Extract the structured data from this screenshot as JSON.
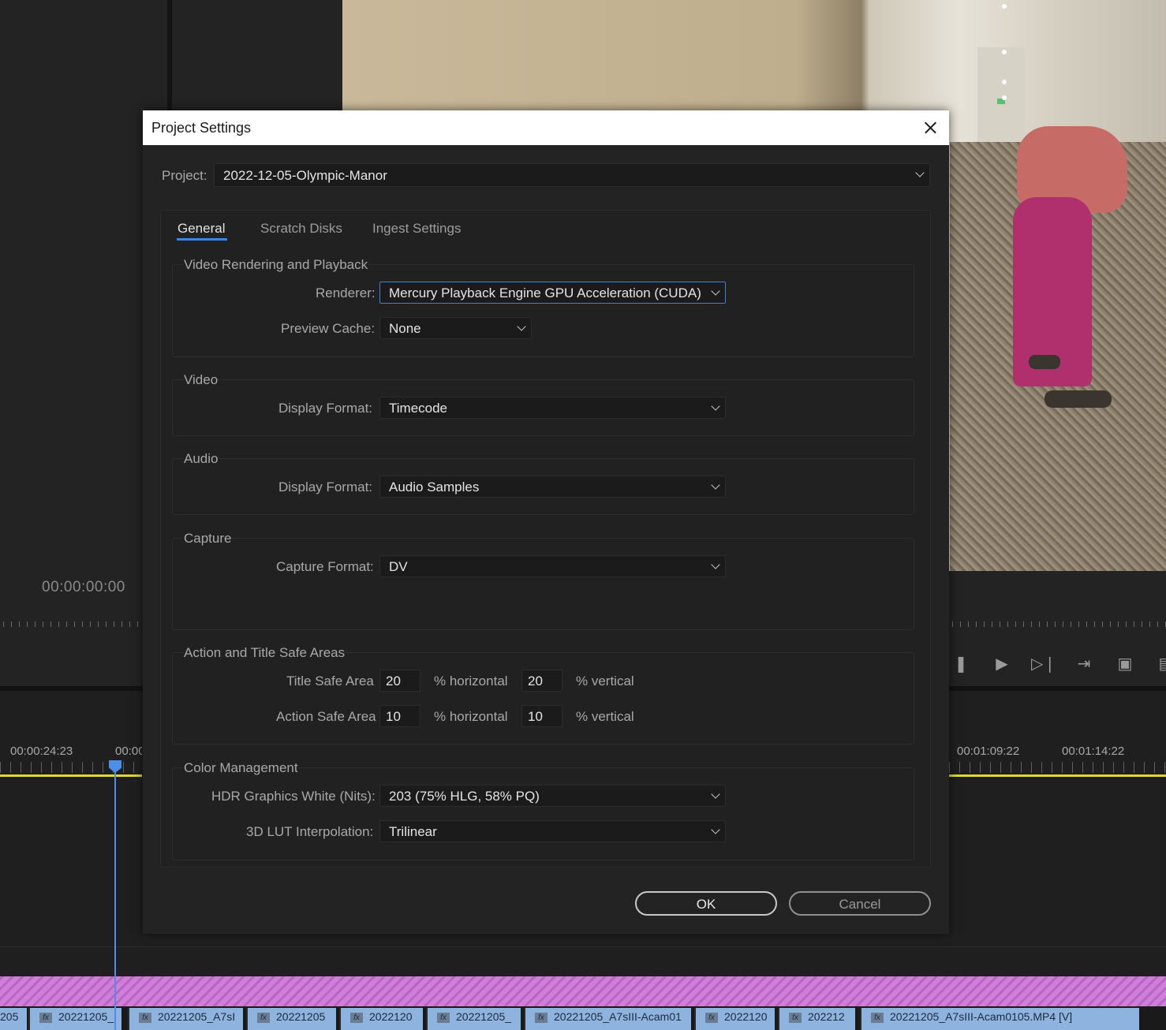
{
  "background": {
    "source_timecode": "00:00:00:00",
    "timeline_timecodes": [
      "00:00:24:23",
      "00:00",
      "00:01:09:22",
      "00:01:14:22"
    ],
    "clips": [
      {
        "label": "205",
        "fx": false
      },
      {
        "label": "20221205_",
        "fx": true
      },
      {
        "label": "20221205_A7sI",
        "fx": true
      },
      {
        "label": "20221205",
        "fx": true
      },
      {
        "label": "2022120",
        "fx": true
      },
      {
        "label": "20221205_",
        "fx": true
      },
      {
        "label": "20221205_A7sIII-Acam01",
        "fx": true
      },
      {
        "label": "2022120",
        "fx": true
      },
      {
        "label": "202212",
        "fx": true
      },
      {
        "label": "20221205_A7sIII-Acam0105.MP4 [V]",
        "fx": true
      }
    ],
    "fx_label": "fx"
  },
  "dialog": {
    "title": "Project Settings",
    "project_label": "Project:",
    "project_value": "2022-12-05-Olympic-Manor",
    "tabs": [
      {
        "label": "General",
        "active": true
      },
      {
        "label": "Scratch Disks",
        "active": false
      },
      {
        "label": "Ingest Settings",
        "active": false
      }
    ],
    "video_rendering": {
      "title": "Video Rendering and Playback",
      "renderer_label": "Renderer:",
      "renderer_value": "Mercury Playback Engine GPU Acceleration (CUDA)",
      "preview_cache_label": "Preview Cache:",
      "preview_cache_value": "None"
    },
    "video": {
      "title": "Video",
      "display_format_label": "Display Format:",
      "display_format_value": "Timecode"
    },
    "audio": {
      "title": "Audio",
      "display_format_label": "Display Format:",
      "display_format_value": "Audio Samples"
    },
    "capture": {
      "title": "Capture",
      "capture_format_label": "Capture Format:",
      "capture_format_value": "DV"
    },
    "safe_areas": {
      "title": "Action and Title Safe Areas",
      "title_safe_label": "Title Safe Area",
      "title_safe_h": "20",
      "title_safe_v": "20",
      "action_safe_label": "Action Safe Area",
      "action_safe_h": "10",
      "action_safe_v": "10",
      "horizontal_label": "% horizontal",
      "vertical_label": "% vertical"
    },
    "color_management": {
      "title": "Color Management",
      "hdr_label": "HDR Graphics White (Nits):",
      "hdr_value": "203 (75% HLG, 58% PQ)",
      "lut_label": "3D LUT Interpolation:",
      "lut_value": "Trilinear"
    },
    "ok_label": "OK",
    "cancel_label": "Cancel"
  },
  "colors": {
    "accent": "#3b84e8",
    "dialog_bg": "#232323",
    "timeline_yellow": "#e3d536",
    "audio_clip": "#c46fd0",
    "video_clip": "#8fb3df"
  }
}
